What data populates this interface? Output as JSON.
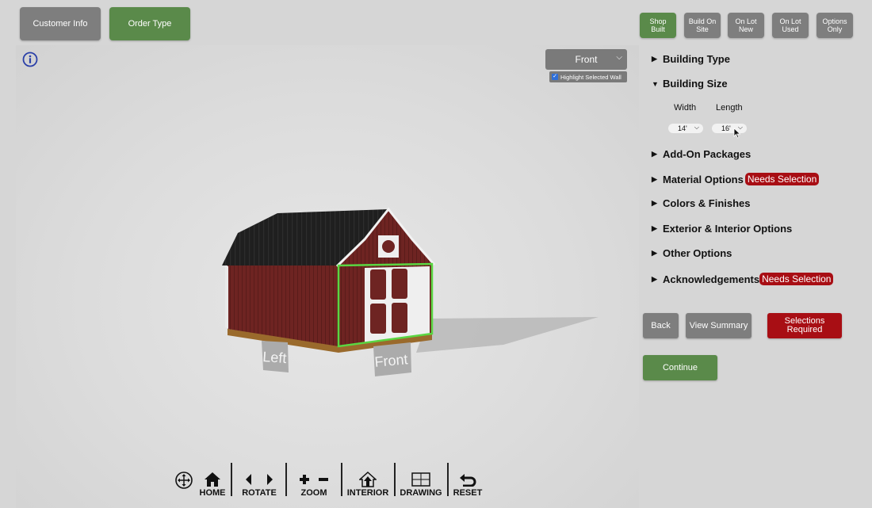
{
  "top_tabs": {
    "customer_info": "Customer Info",
    "order_type": "Order Type"
  },
  "order_types": [
    {
      "label": "Shop\nBuilt",
      "active": true
    },
    {
      "label": "Build On\nSite",
      "active": false
    },
    {
      "label": "On Lot\nNew",
      "active": false
    },
    {
      "label": "On Lot\nUsed",
      "active": false
    },
    {
      "label": "Options\nOnly",
      "active": false
    }
  ],
  "viewer": {
    "wall_select": "Front",
    "highlight_label": "Highlight Selected Wall",
    "highlight_checked": true,
    "wall_labels": {
      "left": "Left",
      "front": "Front"
    }
  },
  "toolbar": {
    "home": "HOME",
    "rotate": "ROTATE",
    "zoom": "ZOOM",
    "interior": "INTERIOR",
    "drawing": "DRAWING",
    "reset": "RESET"
  },
  "panel": {
    "sections": {
      "building_type": "Building Type",
      "building_size": "Building Size",
      "add_on_packages": "Add-On Packages",
      "material_options": "Material Options",
      "colors_finishes": "Colors & Finishes",
      "exterior_interior": "Exterior & Interior Options",
      "other_options": "Other Options",
      "acknowledgements": "Acknowledgements"
    },
    "needs_selection": "Needs Selection",
    "size": {
      "width_label": "Width",
      "length_label": "Length",
      "width_value": "14'",
      "length_value": "16'"
    },
    "buttons": {
      "back": "Back",
      "view_summary": "View Summary",
      "selections_required": "Selections\nRequired",
      "continue": "Continue"
    }
  },
  "colors": {
    "green": "#5a8a4a",
    "gray": "#7e7e7e",
    "red": "#a80e14",
    "barn_red": "#6e2422"
  }
}
